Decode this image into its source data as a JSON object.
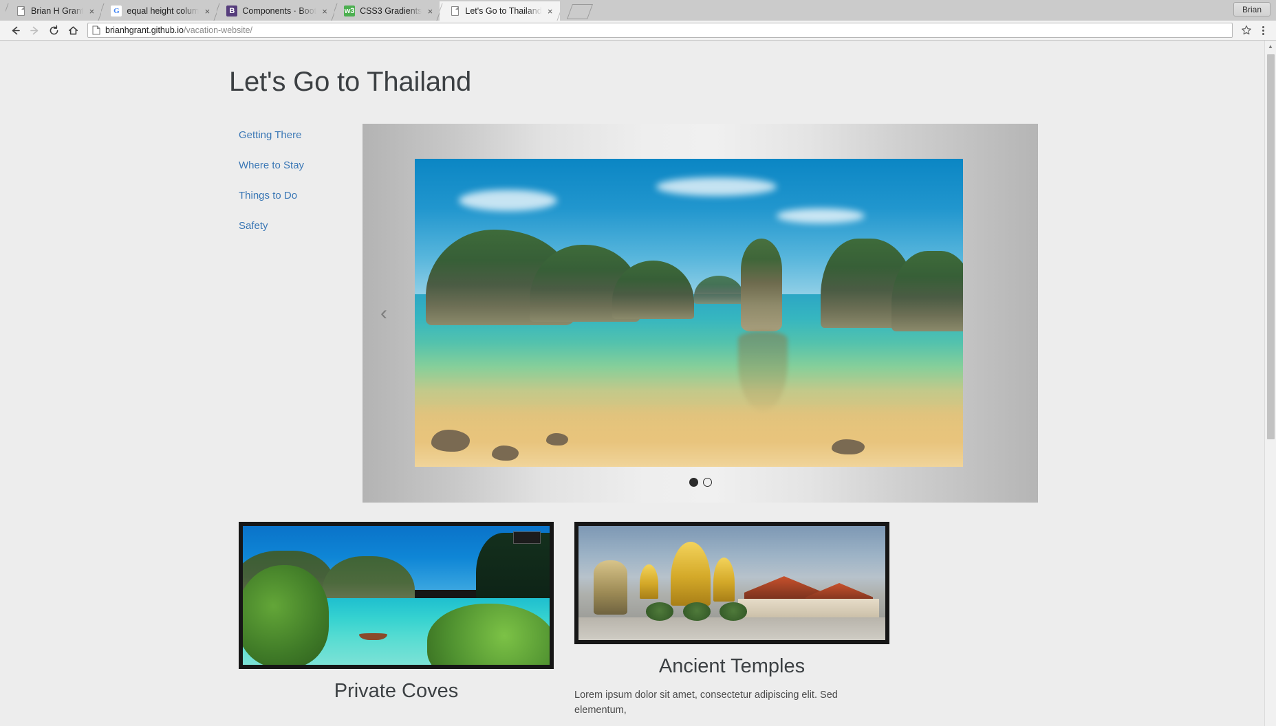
{
  "browser": {
    "tabs": [
      {
        "title": "Brian H Grant",
        "favicon": "document-icon",
        "active": false
      },
      {
        "title": "equal height colum",
        "favicon": "google-icon",
        "active": false
      },
      {
        "title": "Components · Boot",
        "favicon": "bootstrap-icon",
        "active": false
      },
      {
        "title": "CSS3 Gradients",
        "favicon": "w3schools-icon",
        "active": false
      },
      {
        "title": "Let's Go to Thailand",
        "favicon": "document-icon",
        "active": true
      }
    ],
    "close_label": "×",
    "new_tab_label": "",
    "profile_label": "Brian",
    "toolbar": {
      "back_label": "←",
      "forward_label": "→",
      "reload_label": "↻",
      "home_label": "⌂",
      "url_domain": "brianhgrant.github.io",
      "url_path": "/vacation-website/",
      "url_full": "brianhgrant.github.io/vacation-website/",
      "bookmark_label": "☆",
      "menu_label": "⋮"
    }
  },
  "page": {
    "title": "Let's Go to Thailand",
    "sidebar": {
      "items": [
        {
          "label": "Getting There"
        },
        {
          "label": "Where to Stay"
        },
        {
          "label": "Things to Do"
        },
        {
          "label": "Safety"
        }
      ]
    },
    "carousel": {
      "prev_label": "‹",
      "slide_alt": "Thailand limestone karst bay with turquoise water",
      "indicators": [
        {
          "label": "",
          "active": true
        },
        {
          "label": "",
          "active": false
        }
      ]
    },
    "cards": [
      {
        "title": "Private Coves",
        "image_alt": "Turquoise cove with longtail boat and palm foliage",
        "body": ""
      },
      {
        "title": "Ancient Temples",
        "image_alt": "Golden spires of the Grand Palace temple complex",
        "body": "Lorem ipsum dolor sit amet, consectetur adipiscing elit. Sed elementum,"
      }
    ]
  },
  "scrollbar": {
    "up_arrow": "▲"
  },
  "colors": {
    "link": "#3a77b5",
    "heading": "#3c4043",
    "page_bg": "#ededed",
    "card_border": "#161616",
    "chrome_tabstrip": "#cbcbcb",
    "chrome_toolbar": "#f3f3f3"
  }
}
